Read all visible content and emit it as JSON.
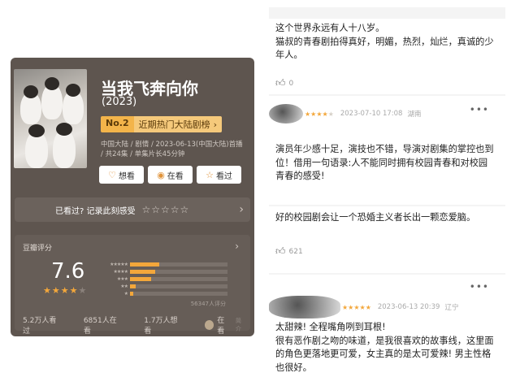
{
  "show": {
    "title": "当我飞奔向你",
    "year": "(2023)",
    "rank_no": "No.2",
    "rank_text": "近期热门大陆剧榜",
    "meta": "中国大陆 / 剧情 / 2023-06-13(中国大陆)首播 / 共24集 / 单集片长45分钟",
    "actions": [
      {
        "label": "想看",
        "icon": "heart-icon"
      },
      {
        "label": "在看",
        "icon": "circle-dot-icon"
      },
      {
        "label": "看过",
        "icon": "star-icon"
      }
    ],
    "seen_prompt": "已看过? 记录此刻感受",
    "rating_label": "豆瓣评分",
    "rating_score": "7.6",
    "rating_stars_filled": 4,
    "distribution": [
      {
        "stars": "★★★★★",
        "fraction": 0.3
      },
      {
        "stars": "★★★★",
        "fraction": 0.26
      },
      {
        "stars": "★★★",
        "fraction": 0.22
      },
      {
        "stars": "★★",
        "fraction": 0.06
      },
      {
        "stars": "★",
        "fraction": 0.03
      }
    ],
    "rating_count": "56347人评分",
    "stats": {
      "watched": "5.2万人看过",
      "watching": "6851人在看",
      "want": "1.7万人想看",
      "zai": "在看",
      "jj": "简介"
    }
  },
  "comments": [
    {
      "text": "这个世界永远有人十八岁。\n猫叔的青春剧拍得真好，明媚，热烈，灿烂，真诚的少年人。",
      "likes": "0"
    },
    {
      "stars_filled": 4,
      "date": "2023-07-10  17:08",
      "location": "湖南",
      "text": "演员年少感十足，演技也不错，导演对剧集的掌控也到位！借用一句语录:人不能同时拥有校园青春和对校园青春的感受!"
    },
    {
      "text": "好的校园剧会让一个恐婚主义者长出一颗恋爱脑。",
      "likes": "621"
    },
    {
      "stars_filled": 5,
      "date": "2023-06-13  20:39",
      "location": "辽宁",
      "text": "太甜辣! 全程嘴角咧到耳根!\n很有恶作剧之吻的味道，是我很喜欢的故事线，这里面的角色更落地更可爱，女主真的是太可爱辣! 男主性格也很好。"
    }
  ]
}
